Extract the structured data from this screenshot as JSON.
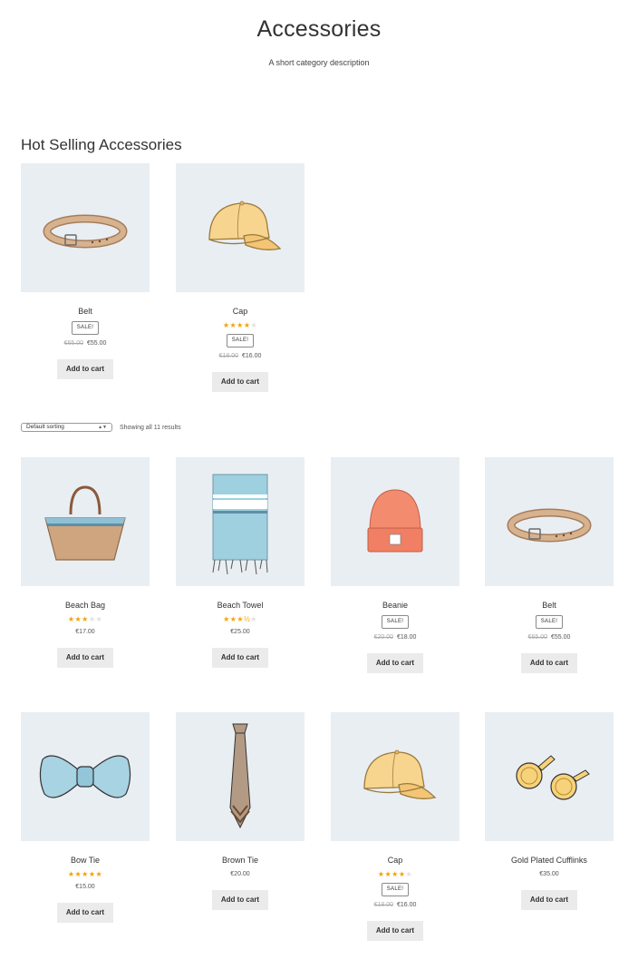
{
  "page": {
    "title": "Accessories",
    "description": "A short category description"
  },
  "hot_selling": {
    "heading": "Hot Selling Accessories",
    "products": [
      {
        "name": "Belt",
        "sale_badge": "SALE!",
        "old_price": "€65.00",
        "price": "€55.00",
        "cta": "Add to cart",
        "icon": "belt-icon"
      },
      {
        "name": "Cap",
        "rating": 4,
        "sale_badge": "SALE!",
        "old_price": "€18.00",
        "price": "€16.00",
        "cta": "Add to cart",
        "icon": "cap-icon"
      }
    ]
  },
  "toolbar": {
    "sort_selected": "Default sorting",
    "result_count": "Showing all 11 results"
  },
  "products": [
    {
      "name": "Beach Bag",
      "rating": 3,
      "price": "€17.00",
      "cta": "Add to cart",
      "icon": "beach-bag-icon"
    },
    {
      "name": "Beach Towel",
      "rating": 3.5,
      "price": "€25.00",
      "cta": "Add to cart",
      "icon": "beach-towel-icon"
    },
    {
      "name": "Beanie",
      "sale_badge": "SALE!",
      "old_price": "€20.00",
      "price": "€18.00",
      "cta": "Add to cart",
      "icon": "beanie-icon"
    },
    {
      "name": "Belt",
      "sale_badge": "SALE!",
      "old_price": "€65.00",
      "price": "€55.00",
      "cta": "Add to cart",
      "icon": "belt-icon"
    },
    {
      "name": "Bow Tie",
      "rating": 5,
      "price": "€15.00",
      "cta": "Add to cart",
      "icon": "bow-tie-icon"
    },
    {
      "name": "Brown Tie",
      "price": "€20.00",
      "cta": "Add to cart",
      "icon": "tie-icon"
    },
    {
      "name": "Cap",
      "rating": 4,
      "sale_badge": "SALE!",
      "old_price": "€18.00",
      "price": "€16.00",
      "cta": "Add to cart",
      "icon": "cap-icon"
    },
    {
      "name": "Gold Plated Cufflinks",
      "price": "€35.00",
      "cta": "Add to cart",
      "icon": "cufflinks-icon"
    }
  ],
  "colors": {
    "thumb_bg": "#e9eef3",
    "star": "#f5a000",
    "button_bg": "#ebebeb"
  }
}
